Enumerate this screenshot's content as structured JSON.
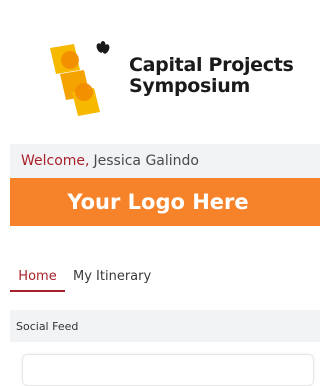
{
  "event": {
    "name_line1": "Capital Projects",
    "name_line2": "Symposium"
  },
  "welcome": {
    "greeting": "Welcome,",
    "user_name": "Jessica Galindo"
  },
  "banner": {
    "text": "Your Logo Here"
  },
  "tabs": [
    {
      "label": "Home",
      "active": true
    },
    {
      "label": "My Itinerary",
      "active": false
    }
  ],
  "feed": {
    "section_title": "Social Feed"
  },
  "colors": {
    "accent": "#a8212a",
    "banner_bg": "#f6822a",
    "logo_yellow": "#f7b800"
  },
  "icons": {
    "logo_mark": "symposium-logo-mark"
  }
}
